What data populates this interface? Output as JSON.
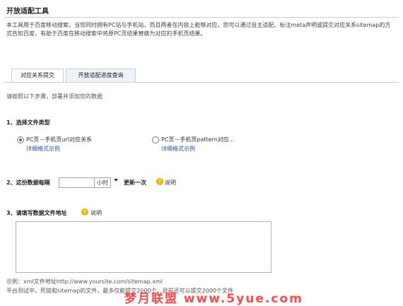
{
  "page": {
    "title": "开放适配工具",
    "description": "本工具用于百度移动搜索。当您同时拥有PC站与手机站，而且两者在内容上能够对应，您可以通过自主适配、标注meta声明或提交对应关系sitemap的方式告知百度，有助于百度在移动搜索中将原PC页结果替换为对应的手机页结果。"
  },
  "tabs": [
    {
      "label": "对应关系提交",
      "active": true
    },
    {
      "label": "开放适配进度查询",
      "active": false
    }
  ],
  "hint": "请按照以下步骤，部署并添加您的数据",
  "step1": {
    "label": "1、选择文件类型",
    "options": [
      {
        "label": "PC页－手机页url对应关系",
        "link": "详细格式示例",
        "selected": true
      },
      {
        "label": "PC页－手机页pattern对应...",
        "link": "详细格式示例",
        "selected": false
      }
    ]
  },
  "step2": {
    "label": "2、这份数据每隔",
    "input_value": "",
    "unit": "小时",
    "suffix": "更新一次",
    "help": "说明"
  },
  "step3": {
    "label": "3、请填写数据文件地址",
    "help": "说明",
    "textarea_value": ""
  },
  "example": "示例：xml文件地址http://www.yoursite.com/sitemap.xml",
  "note": "平台测试中，死链和sitemap的文件，最多仅能提交2000个，目前还可以提交2000个文件",
  "watermark": "梦月联盟 www.5yue.com"
}
